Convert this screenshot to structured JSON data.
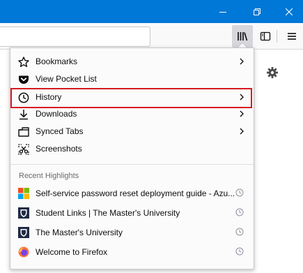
{
  "window": {
    "controls": [
      "minimize-icon",
      "restore-icon",
      "close-icon"
    ],
    "titlebar_color": "#0078d7"
  },
  "toolbar": {
    "buttons": [
      "library-icon",
      "sidebar-icon",
      "hamburger-menu-icon"
    ]
  },
  "library_menu": {
    "items": [
      {
        "label": "Bookmarks",
        "icon": "star-icon",
        "has_submenu": true
      },
      {
        "label": "View Pocket List",
        "icon": "pocket-icon",
        "has_submenu": false
      },
      {
        "label": "History",
        "icon": "clock-icon",
        "has_submenu": true,
        "highlighted": true
      },
      {
        "label": "Downloads",
        "icon": "download-icon",
        "has_submenu": true
      },
      {
        "label": "Synced Tabs",
        "icon": "synced-tabs-icon",
        "has_submenu": true
      },
      {
        "label": "Screenshots",
        "icon": "screenshot-icon",
        "has_submenu": false
      }
    ],
    "recent_header": "Recent Highlights",
    "highlights": [
      {
        "label": "Self-service password reset deployment guide - Azu...",
        "favicon": "microsoft-logo-icon",
        "badge": "visited-clock-icon"
      },
      {
        "label": "Student Links | The Master's University",
        "favicon": "masters-university-shield-icon",
        "badge": "visited-clock-icon"
      },
      {
        "label": "The Master's University",
        "favicon": "masters-university-shield-icon",
        "badge": "visited-clock-icon"
      },
      {
        "label": "Welcome to Firefox",
        "favicon": "firefox-logo-icon",
        "badge": "visited-clock-icon"
      }
    ],
    "highlight_color": "#d71a21"
  }
}
